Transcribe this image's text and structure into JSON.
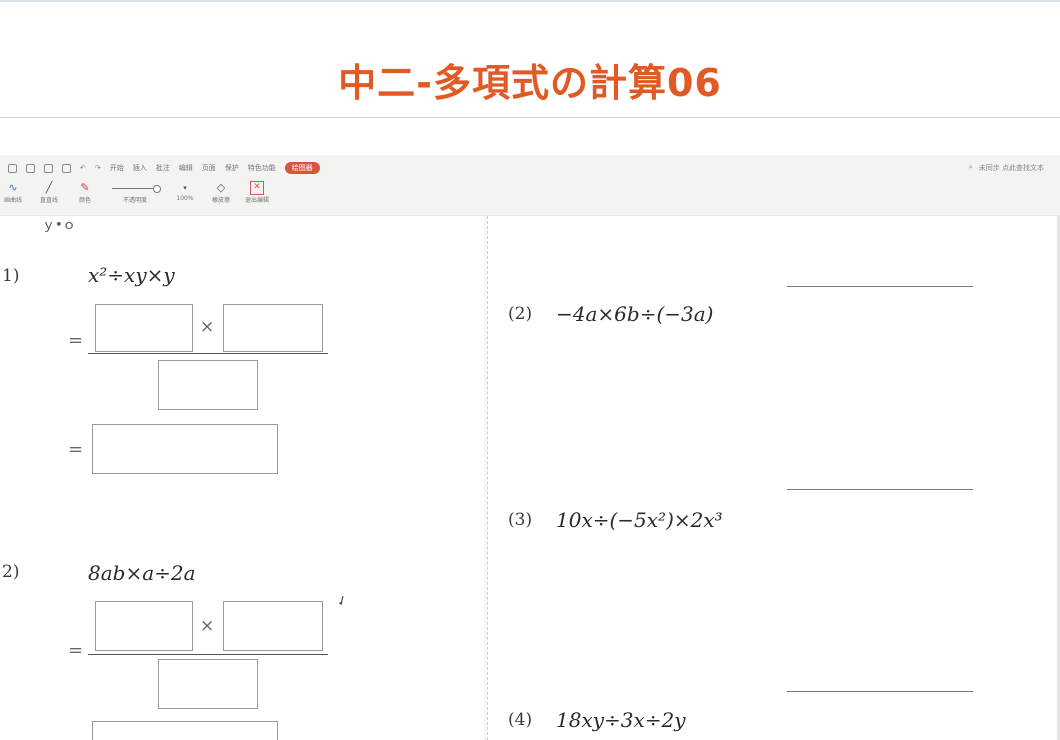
{
  "title": "中二-多項式の計算06",
  "toolbar": {
    "menus": [
      "开始",
      "插入",
      "批注",
      "编辑",
      "页面",
      "保护",
      "特色功能"
    ],
    "active_tab": "绘图器",
    "right_text": "未同步  点此查找文本",
    "tools": [
      "画曲线",
      "直直线",
      "颜色",
      "不透明度",
      "100%",
      "橡皮擦",
      "退出编辑"
    ]
  },
  "left": {
    "p1": {
      "num": "1)",
      "expr": "x²÷xy×y",
      "eq1": "=",
      "times": "×",
      "eq2": "="
    },
    "p2": {
      "num": "2)",
      "expr": "8ab×a÷2a",
      "eq1": "=",
      "times": "×"
    }
  },
  "right": [
    {
      "num": "(2)",
      "expr": "−4a×6b÷(−3a)"
    },
    {
      "num": "(3)",
      "expr": "10x÷(−5x²)×2x³"
    },
    {
      "num": "(4)",
      "expr": "18xy÷3x÷2y"
    }
  ],
  "colors": {
    "title": "#e15a25",
    "active_tab": "#e0503f"
  }
}
